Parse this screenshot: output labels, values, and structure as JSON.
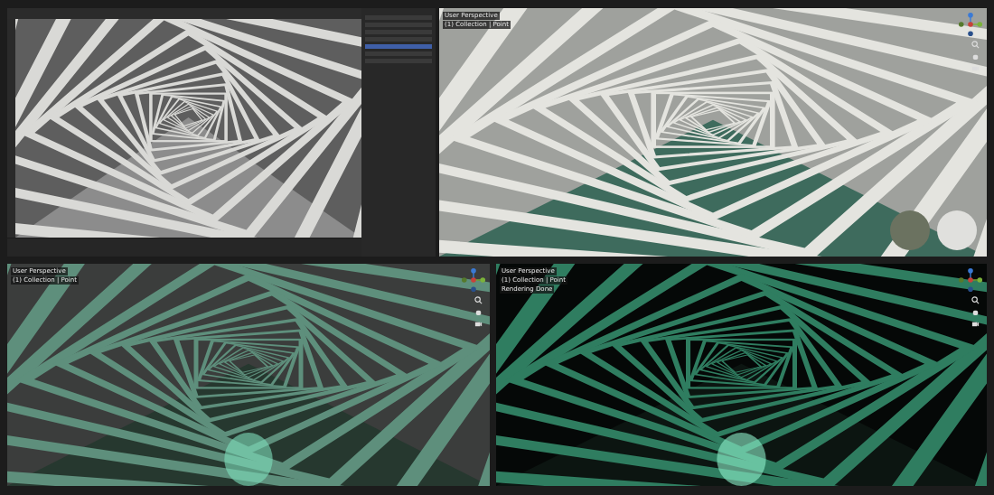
{
  "viewports": [
    {
      "kind": "solid"
    },
    {
      "kind": "material",
      "labels": [
        "User Perspective",
        "(1) Collection | Point"
      ]
    },
    {
      "kind": "eevee",
      "labels": [
        "User Perspective",
        "(1) Collection | Point"
      ]
    },
    {
      "kind": "cycles",
      "labels": [
        "User Perspective",
        "(1) Collection | Point",
        "Rendering Done"
      ]
    }
  ]
}
